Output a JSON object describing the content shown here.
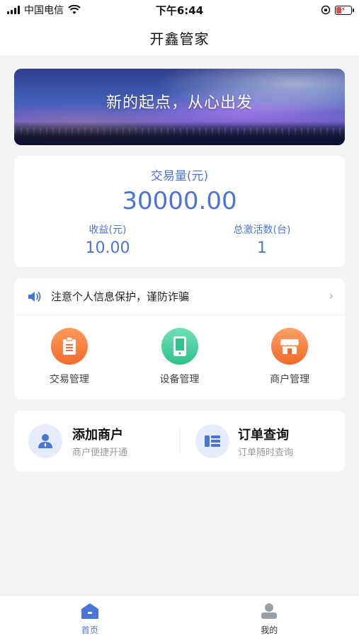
{
  "status_bar": {
    "carrier": "中国电信",
    "time": "下午6:44"
  },
  "nav": {
    "title": "开鑫管家"
  },
  "banner": {
    "text": "新的起点，从心出发"
  },
  "stats": {
    "volume_label": "交易量(元)",
    "volume_value": "30000.00",
    "income_label": "收益(元)",
    "income_value": "10.00",
    "activations_label": "总激活数(台)",
    "activations_value": "1"
  },
  "notice": {
    "text": "注意个人信息保护，谨防诈骗"
  },
  "menu": [
    {
      "label": "交易管理",
      "icon": "clipboard-icon"
    },
    {
      "label": "设备管理",
      "icon": "phone-device-icon"
    },
    {
      "label": "商户管理",
      "icon": "storefront-icon"
    }
  ],
  "quick": {
    "add_merchant": {
      "title": "添加商户",
      "subtitle": "商户便捷开通"
    },
    "order_query": {
      "title": "订单查询",
      "subtitle": "订单随时查询"
    }
  },
  "tabs": [
    {
      "label": "首页",
      "active": true
    },
    {
      "label": "我的",
      "active": false
    }
  ],
  "colors": {
    "accent": "#4a74d6",
    "orange": "#f26b2c",
    "green": "#30c18d"
  }
}
